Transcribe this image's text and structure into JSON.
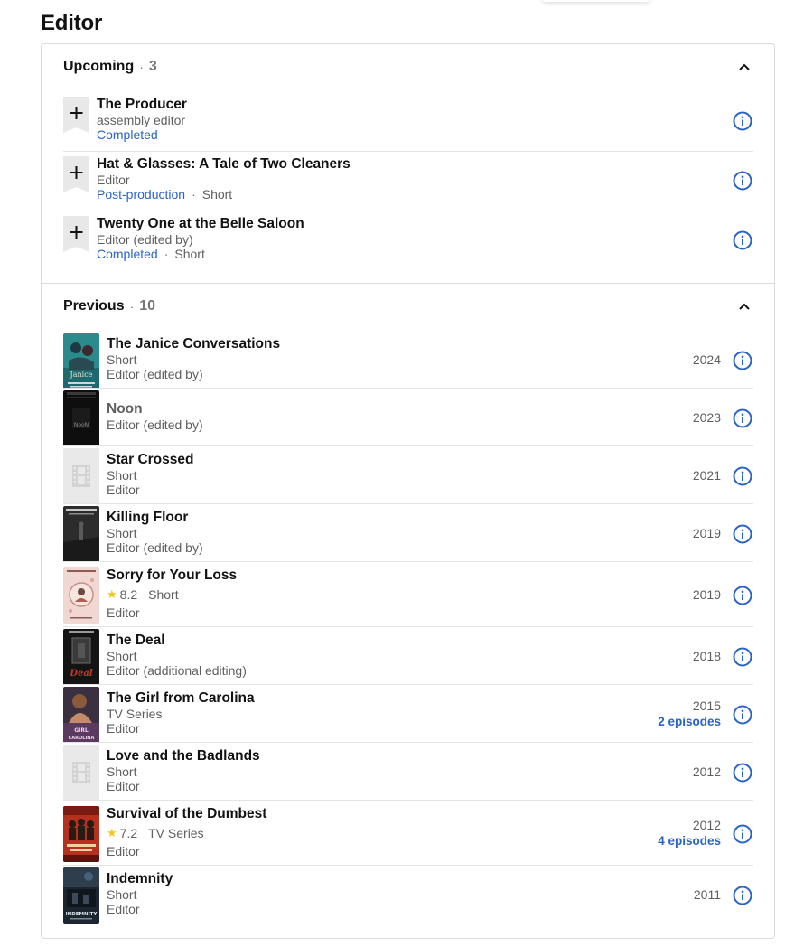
{
  "page": {
    "heading": "Editor"
  },
  "upcoming": {
    "title": "Upcoming",
    "separator": "·",
    "count": "3",
    "items": [
      {
        "title": "The Producer",
        "role": "assembly editor",
        "status": "Completed",
        "type": ""
      },
      {
        "title": "Hat & Glasses: A Tale of Two Cleaners",
        "role": "Editor",
        "status": "Post-production",
        "type": "Short"
      },
      {
        "title": "Twenty One at the Belle Saloon",
        "role": "Editor (edited by)",
        "status": "Completed",
        "type": "Short"
      }
    ]
  },
  "previous": {
    "title": "Previous",
    "separator": "·",
    "count": "10",
    "items": [
      {
        "title": "The Janice Conversations",
        "type": "Short",
        "role": "Editor (edited by)",
        "year": "2024",
        "poster": "janice"
      },
      {
        "title": "Noon",
        "role": "Editor (edited by)",
        "year": "2023",
        "poster": "noon"
      },
      {
        "title": "Star Crossed",
        "type": "Short",
        "role": "Editor",
        "year": "2021",
        "poster": "placeholder"
      },
      {
        "title": "Killing Floor",
        "type": "Short",
        "role": "Editor (edited by)",
        "year": "2019",
        "poster": "killing"
      },
      {
        "title": "Sorry for Your Loss",
        "rating": "8.2",
        "type": "Short",
        "role": "Editor",
        "year": "2019",
        "poster": "sorry"
      },
      {
        "title": "The Deal",
        "type": "Short",
        "role": "Editor (additional editing)",
        "year": "2018",
        "poster": "deal"
      },
      {
        "title": "The Girl from Carolina",
        "type": "TV Series",
        "role": "Editor",
        "year": "2015",
        "episodes": "2 episodes",
        "poster": "carolina"
      },
      {
        "title": "Love and the Badlands",
        "type": "Short",
        "role": "Editor",
        "year": "2012",
        "poster": "placeholder"
      },
      {
        "title": "Survival of the Dumbest",
        "rating": "7.2",
        "type": "TV Series",
        "role": "Editor",
        "year": "2012",
        "episodes": "4 episodes",
        "poster": "survival"
      },
      {
        "title": "Indemnity",
        "type": "Short",
        "role": "Editor",
        "year": "2011",
        "poster": "indemnity"
      }
    ]
  },
  "icons": {
    "add": "add-to-watchlist-icon",
    "info": "info-icon",
    "collapse": "chevron-up-icon",
    "rating": "star-icon"
  },
  "colors": {
    "link": "#2a63c7",
    "star": "#f5c518",
    "text": "#121212",
    "muted": "#5f5f5f",
    "border": "#dcdcdc"
  }
}
